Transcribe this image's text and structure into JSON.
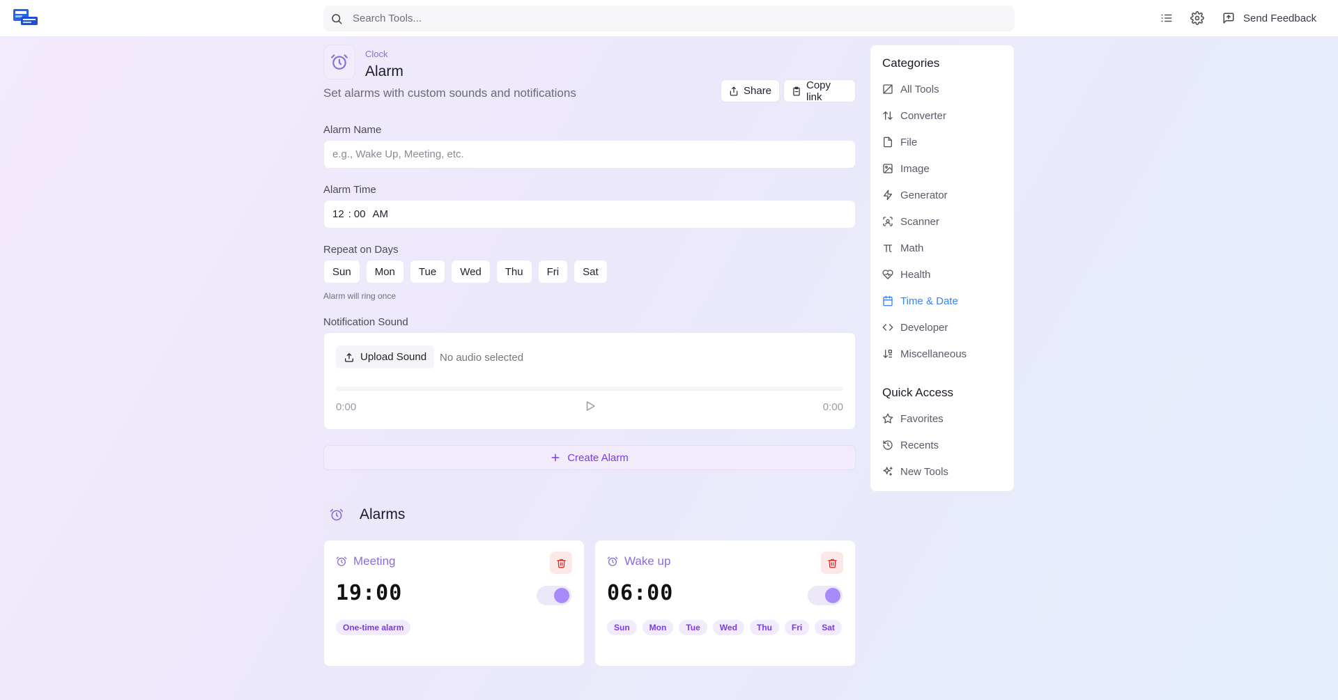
{
  "header": {
    "search_placeholder": "Search Tools...",
    "feedback_label": "Send Feedback"
  },
  "page": {
    "breadcrumb": "Clock",
    "title": "Alarm",
    "subtitle": "Set alarms with custom sounds and notifications",
    "share_label": "Share",
    "copy_label": "Copy link"
  },
  "form": {
    "name_label": "Alarm Name",
    "name_placeholder": "e.g., Wake Up, Meeting, etc.",
    "time_label": "Alarm Time",
    "time_hour": "12",
    "time_sep": ":",
    "time_minute": "00",
    "time_period": "AM",
    "repeat_label": "Repeat on Days",
    "days": [
      "Sun",
      "Mon",
      "Tue",
      "Wed",
      "Thu",
      "Fri",
      "Sat"
    ],
    "repeat_hint": "Alarm will ring once",
    "sound_label": "Notification Sound",
    "upload_label": "Upload Sound",
    "no_audio": "No audio selected",
    "time_start": "0:00",
    "time_end": "0:00",
    "create_label": "Create Alarm"
  },
  "alarms": {
    "title": "Alarms",
    "items": [
      {
        "name": "Meeting",
        "time": "19:00",
        "enabled": true,
        "tags": [
          "One-time alarm"
        ]
      },
      {
        "name": "Wake up",
        "time": "06:00",
        "enabled": true,
        "tags": [
          "Sun",
          "Mon",
          "Tue",
          "Wed",
          "Thu",
          "Fri",
          "Sat"
        ]
      }
    ]
  },
  "sidebar": {
    "categories_title": "Categories",
    "categories": [
      {
        "label": "All Tools",
        "icon": "all-tools-icon"
      },
      {
        "label": "Converter",
        "icon": "converter-icon"
      },
      {
        "label": "File",
        "icon": "file-icon"
      },
      {
        "label": "Image",
        "icon": "image-icon"
      },
      {
        "label": "Generator",
        "icon": "lightning-icon"
      },
      {
        "label": "Scanner",
        "icon": "scanner-icon"
      },
      {
        "label": "Math",
        "icon": "pi-icon"
      },
      {
        "label": "Health",
        "icon": "heart-icon"
      },
      {
        "label": "Time & Date",
        "icon": "calendar-icon"
      },
      {
        "label": "Developer",
        "icon": "code-icon"
      },
      {
        "label": "Miscellaneous",
        "icon": "sort-icon"
      }
    ],
    "quick_title": "Quick Access",
    "quick": [
      {
        "label": "Favorites",
        "icon": "star-icon"
      },
      {
        "label": "Recents",
        "icon": "history-icon"
      },
      {
        "label": "New Tools",
        "icon": "sparkle-icon"
      }
    ],
    "active_category": "Time & Date"
  },
  "colors": {
    "accent": "#7c3aed",
    "active_link": "#3b82f6",
    "danger": "#dc2626"
  }
}
